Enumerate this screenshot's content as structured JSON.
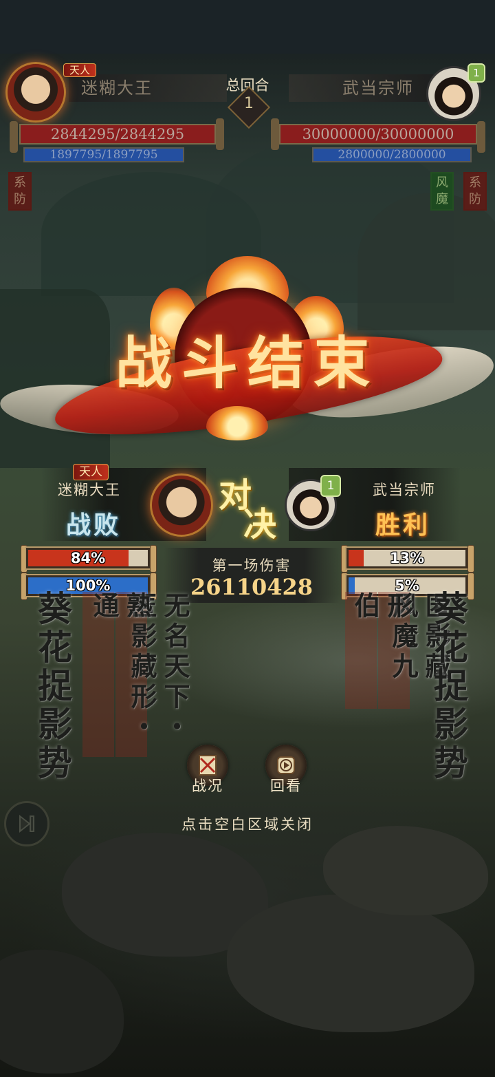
{
  "top_hud": {
    "player": {
      "title_badge": "天人",
      "name": "迷糊大王",
      "hp": "2844295/2844295",
      "mp": "1897795/1897795",
      "buff_banner": [
        "系",
        "防"
      ]
    },
    "round": {
      "label": "总回合",
      "number": "1"
    },
    "opponent": {
      "name": "武当宗师",
      "level": "1",
      "hp": "30000000/30000000",
      "mp": "2800000/2800000",
      "buff_banners": [
        [
          "风",
          "魔"
        ],
        [
          "系",
          "防"
        ]
      ]
    }
  },
  "title": "战斗结束",
  "versus": {
    "vs_glyphs": [
      "对",
      "决"
    ],
    "left": {
      "badge": "天人",
      "name": "迷糊大王",
      "result": "战败",
      "hp_percent": 84,
      "hp_label": "84%",
      "mp_percent": 100,
      "mp_label": "100%"
    },
    "right": {
      "level": "1",
      "name": "武当宗师",
      "result": "胜利",
      "hp_percent": 13,
      "hp_label": "13%",
      "mp_percent": 5,
      "mp_label": "5%"
    },
    "damage_label": "第一场伤害",
    "damage_value": "26110428"
  },
  "skills": {
    "left_big": "葵花捉影势",
    "left_col1": "匿影藏形・通",
    "left_col2": "无名天下・熟",
    "right_col1": "风魔九伯",
    "right_col2": "匿影藏形",
    "right_big": "葵花捉影势"
  },
  "buttons": {
    "report": "战况",
    "replay": "回看"
  },
  "close_hint": "点击空白区域关闭",
  "colors": {
    "hp_fill": "#c8341c",
    "mp_fill": "#2c6ec8",
    "win": "#ffc154",
    "lose": "#c9e6ee"
  }
}
